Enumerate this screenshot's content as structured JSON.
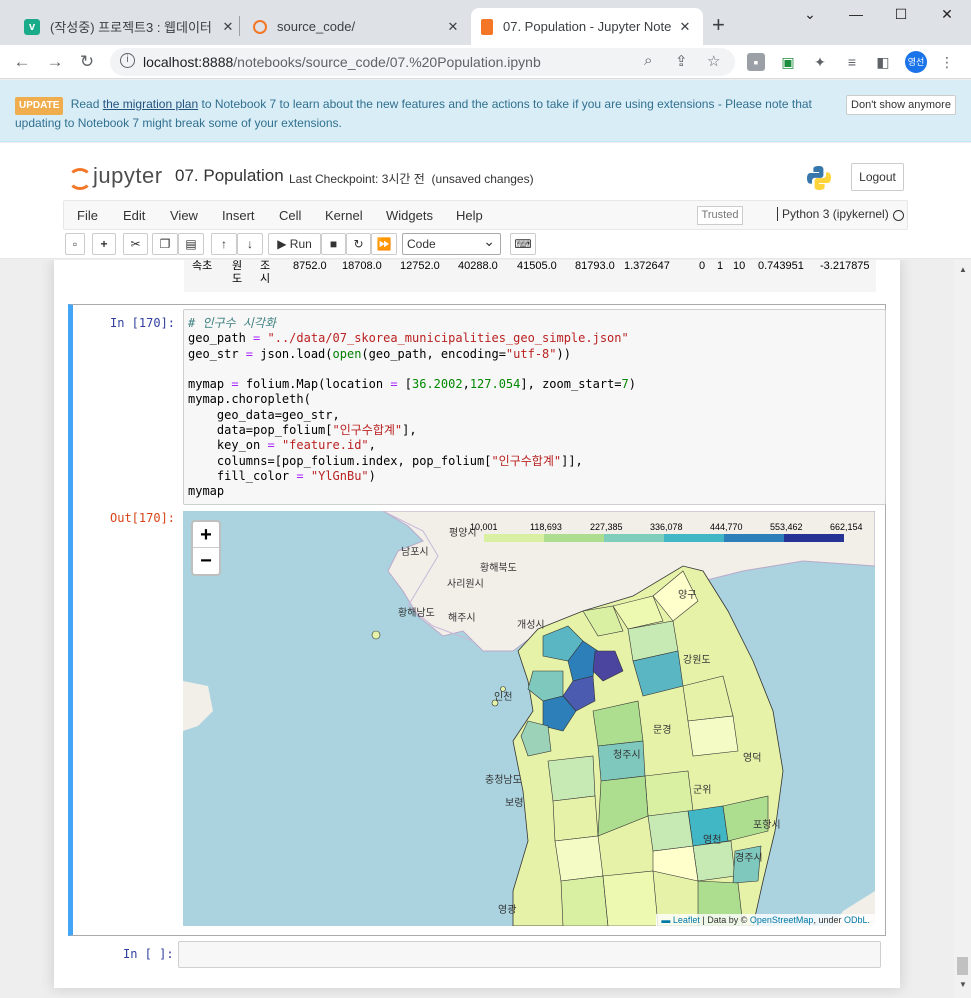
{
  "browser": {
    "tabs": [
      {
        "title": "(작성중) 프로젝트3 : 웹데이터",
        "favicon_letter": "v"
      },
      {
        "title": "source_code/"
      },
      {
        "title": "07. Population - Jupyter Notel"
      }
    ],
    "url_host": "localhost:8888",
    "url_path": "/notebooks/source_code/07.%20Population.ipynb",
    "profile_label": "영선"
  },
  "banner": {
    "badge": "UPDATE",
    "text_1": "Read",
    "link": "the migration plan",
    "text_2": "to Notebook 7 to learn about the new features and the actions to take if you are using extensions - Please note that updating to Notebook 7 might break some of your extensions.",
    "button": "Don't show anymore"
  },
  "jupyter": {
    "logo_text": "jupyter",
    "notebook_name": "07. Population",
    "checkpoint": "Last Checkpoint: 3시간 전",
    "unsaved": "(unsaved changes)",
    "logout": "Logout",
    "menus": [
      "File",
      "Edit",
      "View",
      "Insert",
      "Cell",
      "Kernel",
      "Widgets",
      "Help"
    ],
    "trusted": "Trusted",
    "kernel": "Python 3 (ipykernel)",
    "run_label": "Run",
    "cell_type": "Code"
  },
  "prev_output_row": {
    "index": "속초",
    "col1": "원\n도",
    "col2": "조\n시",
    "values": [
      "8752.0",
      "18708.0",
      "12752.0",
      "40288.0",
      "41505.0",
      "81793.0",
      "1.372647",
      "0",
      "1",
      "10",
      "0.743951",
      "-3.217875"
    ]
  },
  "cell": {
    "in_prompt": "In [170]:",
    "out_prompt": "Out[170]:",
    "empty_prompt": "In [ ]:",
    "code_lines": [
      "# 인구수 시각화",
      "geo_path = \"../data/07_skorea_municipalities_geo_simple.json\"",
      "geo_str = json.load(open(geo_path, encoding=\"utf-8\"))",
      "",
      "mymap = folium.Map(location = [36.2002,127.054], zoom_start=7)",
      "mymap.choropleth(",
      "    geo_data=geo_str,",
      "    data=pop_folium[\"인구수합계\"],",
      "    key_on = \"feature.id\",",
      "    columns=[pop_folium.index, pop_folium[\"인구수합계\"]],",
      "    fill_color = \"YlGnBu\")",
      "mymap"
    ]
  },
  "map": {
    "zoom_in": "+",
    "zoom_out": "−",
    "legend_ticks": [
      "10,001",
      "118,693",
      "227,385",
      "336,078",
      "444,770",
      "553,462",
      "662,154"
    ],
    "legend_colors": [
      "#ffffcc",
      "#d9f0a3",
      "#addd8e",
      "#7fcdbb",
      "#41b6c4",
      "#2c7fb8",
      "#253494"
    ],
    "attribution_leaflet": "Leaflet",
    "attribution_mid": "| Data by ©",
    "attribution_osm": "OpenStreetMap",
    "attribution_under": ", under",
    "attribution_license": "ODbL.",
    "place_labels": [
      "평양시",
      "남포시",
      "황해북도",
      "사리원시",
      "황해남도",
      "해주시",
      "개성시",
      "인천",
      "강원도",
      "충청남도",
      "보령",
      "영광",
      "청주시",
      "포항시",
      "경주시",
      "영천",
      "문경",
      "양구",
      "영덕",
      "군위"
    ]
  },
  "colors": {
    "accent_cell": "#42a5f5",
    "in_prompt": "#303f9f",
    "out_prompt": "#d84315",
    "banner_bg": "#d9edf7",
    "sea": "#aad3df"
  }
}
